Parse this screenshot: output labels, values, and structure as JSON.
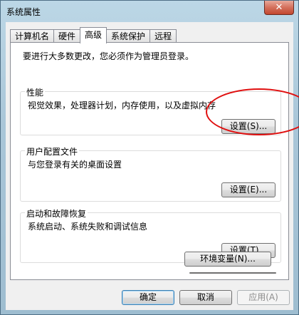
{
  "window": {
    "title": "系统属性",
    "close_glyph": "✕"
  },
  "tabs": [
    {
      "label": "计算机名",
      "active": false
    },
    {
      "label": "硬件",
      "active": false
    },
    {
      "label": "高级",
      "active": true
    },
    {
      "label": "系统保护",
      "active": false
    },
    {
      "label": "远程",
      "active": false
    }
  ],
  "advanced": {
    "notice": "要进行大多数更改，您必须作为管理员登录。",
    "performance": {
      "title": "性能",
      "description": "视觉效果，处理器计划，内存使用，以及虚拟内存",
      "settings_label": "设置(S)..."
    },
    "user_profiles": {
      "title": "用户配置文件",
      "description": "与您登录有关的桌面设置",
      "settings_label": "设置(E)..."
    },
    "startup_recovery": {
      "title": "启动和故障恢复",
      "description": "系统启动、系统失败和调试信息",
      "settings_label": "设置(T)..."
    },
    "env_vars_label": "环境变量(N)..."
  },
  "footer": {
    "ok_label": "确定",
    "cancel_label": "取消",
    "apply_label": "应用(A)"
  },
  "colors": {
    "annotation_red": "#e01010"
  }
}
